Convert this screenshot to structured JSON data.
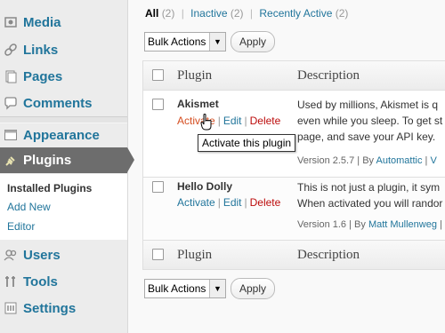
{
  "sidebar": {
    "items": [
      {
        "label": "Media",
        "icon": "media-icon"
      },
      {
        "label": "Links",
        "icon": "links-icon"
      },
      {
        "label": "Pages",
        "icon": "pages-icon"
      },
      {
        "label": "Comments",
        "icon": "comments-icon"
      },
      {
        "label": "Appearance",
        "icon": "appearance-icon"
      },
      {
        "label": "Plugins",
        "icon": "plugins-icon"
      },
      {
        "label": "Users",
        "icon": "users-icon"
      },
      {
        "label": "Tools",
        "icon": "tools-icon"
      },
      {
        "label": "Settings",
        "icon": "settings-icon"
      }
    ],
    "submenu": [
      "Installed Plugins",
      "Add New",
      "Editor"
    ]
  },
  "filters": {
    "all_label": "All",
    "all_count": "(2)",
    "inactive_label": "Inactive",
    "inactive_count": "(2)",
    "recent_label": "Recently Active",
    "recent_count": "(2)"
  },
  "bulk": {
    "label": "Bulk Actions",
    "apply": "Apply"
  },
  "table": {
    "col_plugin": "Plugin",
    "col_description": "Description",
    "rows": [
      {
        "name": "Akismet",
        "activate": "Activate",
        "edit": "Edit",
        "delete": "Delete",
        "desc_lines": [
          "Used by millions, Akismet is q",
          "even while you sleep. To get st",
          "page, and save your API key."
        ],
        "version": "Version 2.5.7",
        "by": "By",
        "author": "Automattic",
        "more": "V"
      },
      {
        "name": "Hello Dolly",
        "activate": "Activate",
        "edit": "Edit",
        "delete": "Delete",
        "desc_lines": [
          "This is not just a plugin, it sym",
          "When activated you will randor"
        ],
        "version": "Version 1.6",
        "by": "By",
        "author": "Matt Mullenweg",
        "more": "V"
      }
    ]
  },
  "tooltip": "Activate this plugin",
  "colors": {
    "link": "#21759b",
    "delete": "#bc0b0b",
    "active_menu": "#6d6d6d"
  }
}
